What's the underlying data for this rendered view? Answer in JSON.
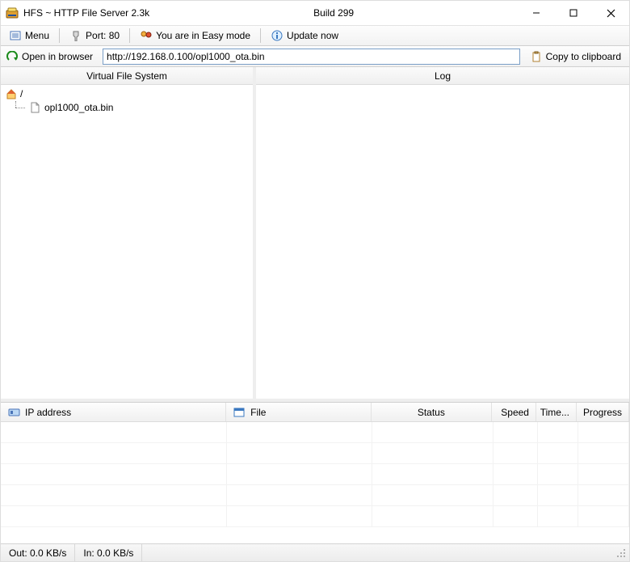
{
  "title": "HFS ~ HTTP File Server 2.3k",
  "build": "Build 299",
  "toolbar": {
    "menu": "Menu",
    "port_label": "Port: 80",
    "mode_text": "You are in Easy mode",
    "update": "Update now"
  },
  "urlrow": {
    "open_browser": "Open in browser",
    "url": "http://192.168.0.100/opl1000_ota.bin",
    "copy": "Copy to clipboard"
  },
  "panes": {
    "vfs_header": "Virtual File System",
    "log_header": "Log",
    "tree": {
      "root_label": "/",
      "child_label": "opl1000_ota.bin"
    }
  },
  "grid": {
    "headers": {
      "ip": "IP address",
      "file": "File",
      "status": "Status",
      "speed": "Speed",
      "time_left": "Time...",
      "progress": "Progress"
    }
  },
  "status": {
    "out": "Out: 0.0 KB/s",
    "in": "In: 0.0 KB/s"
  }
}
